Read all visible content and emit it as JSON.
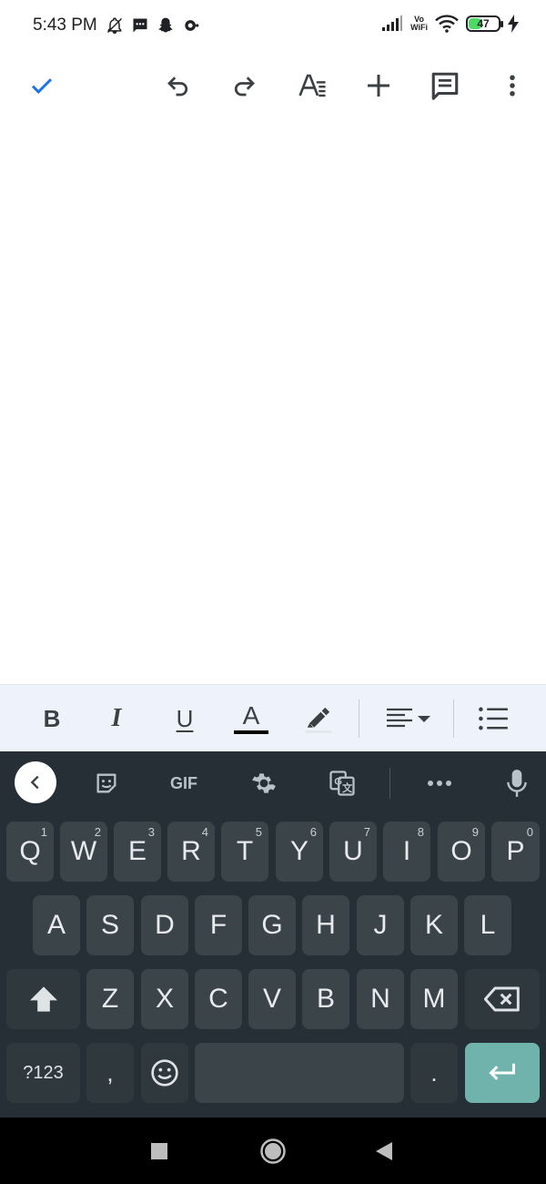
{
  "status_bar": {
    "time": "5:43 PM",
    "vowifi_line1": "Vo",
    "vowifi_line2": "WiFi",
    "battery_level": "47",
    "battery_fraction": 0.47
  },
  "doc_toolbar": {
    "icons": [
      "check-icon",
      "undo-icon",
      "redo-icon",
      "text-format-icon",
      "insert-plus-icon",
      "comment-icon",
      "more-vert-icon"
    ],
    "accent_color": "#1a73e8"
  },
  "format_bar": {
    "bold": "B",
    "italic": "I",
    "underline": "U",
    "text_color": "A",
    "text_color_swatch": "#000000"
  },
  "keyboard_toolbar": {
    "gif": "GIF"
  },
  "keyboard": {
    "row1": [
      {
        "label": "Q",
        "hint": "1"
      },
      {
        "label": "W",
        "hint": "2"
      },
      {
        "label": "E",
        "hint": "3"
      },
      {
        "label": "R",
        "hint": "4"
      },
      {
        "label": "T",
        "hint": "5"
      },
      {
        "label": "Y",
        "hint": "6"
      },
      {
        "label": "U",
        "hint": "7"
      },
      {
        "label": "I",
        "hint": "8"
      },
      {
        "label": "O",
        "hint": "9"
      },
      {
        "label": "P",
        "hint": "0"
      }
    ],
    "row2": [
      "A",
      "S",
      "D",
      "F",
      "G",
      "H",
      "J",
      "K",
      "L"
    ],
    "row3": [
      "Z",
      "X",
      "C",
      "V",
      "B",
      "N",
      "M"
    ],
    "symbols": "?123",
    "comma": ",",
    "period": ".",
    "enter_color": "#6fb3ac"
  }
}
